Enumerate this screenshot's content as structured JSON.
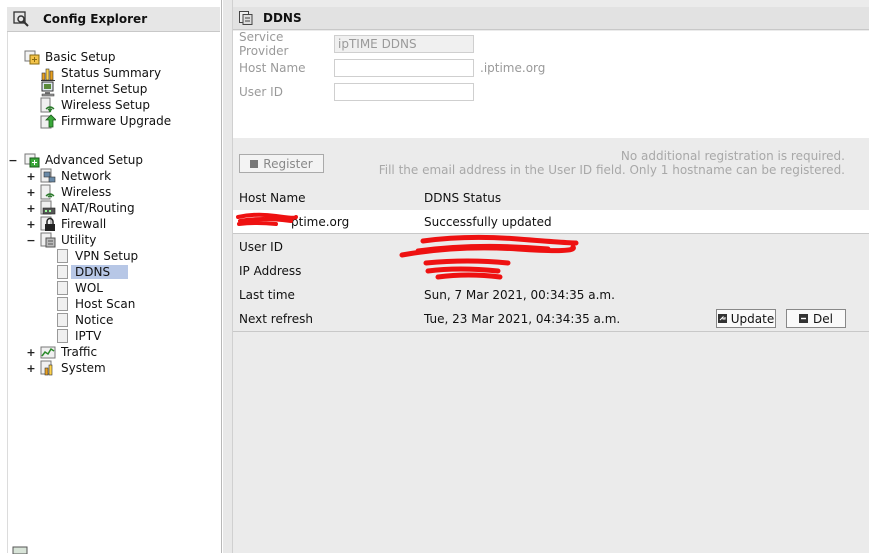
{
  "explorer": {
    "title": "Config Explorer",
    "tree": {
      "basic_setup": {
        "label": "Basic Setup",
        "children": [
          "Status Summary",
          "Internet Setup",
          "Wireless Setup",
          "Firmware Upgrade"
        ]
      },
      "advanced_setup": {
        "label": "Advanced Setup",
        "toggle": "−",
        "children": [
          {
            "label": "Network",
            "toggle": "+"
          },
          {
            "label": "Wireless",
            "toggle": "+"
          },
          {
            "label": "NAT/Routing",
            "toggle": "+"
          },
          {
            "label": "Firewall",
            "toggle": "+"
          },
          {
            "label": "Utility",
            "toggle": "−"
          },
          {
            "label": "Traffic",
            "toggle": "+"
          },
          {
            "label": "System",
            "toggle": "+"
          }
        ],
        "utility_children": [
          "VPN Setup",
          "DDNS",
          "WOL",
          "Host Scan",
          "Notice",
          "IPTV"
        ],
        "selected": "DDNS"
      }
    }
  },
  "ddns": {
    "title": "DDNS",
    "form": {
      "service_provider_label": "Service Provider",
      "service_provider_value": "ipTIME DDNS",
      "host_name_label": "Host Name",
      "host_name_value": "",
      "host_name_suffix": ".iptime.org",
      "user_id_label": "User ID",
      "user_id_value": ""
    },
    "register_button": "Register",
    "note_line1": "No additional registration is required.",
    "note_line2": "Fill the email address in the User ID field. Only 1 hostname can be registered.",
    "table": {
      "header_host": "Host Name",
      "header_status": "DDNS Status",
      "host_value": "ptime.org",
      "status_value": "Successfully updated",
      "user_id_label": "User ID",
      "ip_address_label": "IP Address",
      "last_time_label": "Last time",
      "last_time_value": "Sun, 7 Mar 2021, 00:34:35 a.m.",
      "next_refresh_label": "Next refresh",
      "next_refresh_value": "Tue, 23 Mar 2021, 04:34:35 a.m.",
      "update_button": "Update",
      "del_button": "Del"
    }
  },
  "colors": {
    "selection": "#b7c7e6",
    "redaction": "#ee1111",
    "panel_bg": "#ebebeb"
  }
}
